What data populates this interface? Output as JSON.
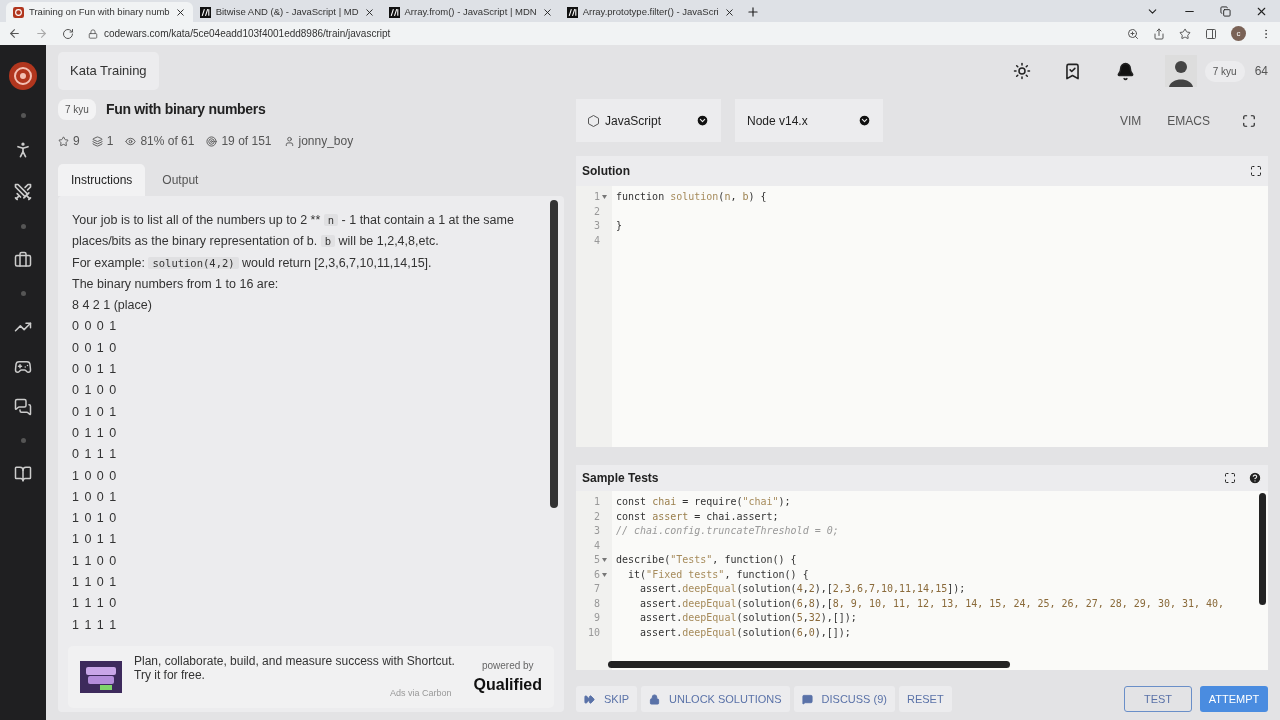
{
  "browser": {
    "tabs": [
      {
        "title": "Training on Fun with binary numb",
        "selected": true,
        "kind": "codewars"
      },
      {
        "title": "Bitwise AND (&) - JavaScript | MD",
        "selected": false,
        "kind": "mdn"
      },
      {
        "title": "Array.from() - JavaScript | MDN",
        "selected": false,
        "kind": "mdn"
      },
      {
        "title": "Array.prototype.filter() - JavaScri",
        "selected": false,
        "kind": "mdn"
      }
    ],
    "url": "codewars.com/kata/5ce04eadd103f4001edd8986/train/javascript",
    "profile_initial": "c"
  },
  "header": {
    "title": "Kata Training",
    "rank": "7 kyu",
    "honor": "64"
  },
  "kata": {
    "rank": "7 kyu",
    "title": "Fun with binary numbers",
    "stats": [
      {
        "kind": "stars",
        "text": "9"
      },
      {
        "kind": "collections",
        "text": "1"
      },
      {
        "kind": "satisfaction",
        "text": "81%",
        "suffix": "of 61"
      },
      {
        "kind": "completed",
        "text": "19",
        "suffix": "of 151"
      },
      {
        "kind": "author",
        "text": "jonny_boy"
      }
    ],
    "tabs": [
      {
        "label": "Instructions",
        "selected": true
      },
      {
        "label": "Output",
        "selected": false
      }
    ],
    "instructions": [
      [
        {
          "text": "Your job is to list all of the numbers up to 2 ** ",
          "kind": "text"
        },
        {
          "text": "n",
          "kind": "code"
        },
        {
          "text": " - 1 that contain a 1 at the same places/bits as the binary representation of b. ",
          "kind": "text"
        },
        {
          "text": "b",
          "kind": "code"
        },
        {
          "text": " will be 1,2,4,8,etc.",
          "kind": "text"
        }
      ],
      [
        {
          "text": "For example: ",
          "kind": "text"
        },
        {
          "text": "solution(4,2)",
          "kind": "code"
        },
        {
          "text": " would return [2,3,6,7,10,11,14,15].",
          "kind": "text"
        }
      ],
      [
        {
          "text": "The binary numbers from 1 to 16 are:",
          "kind": "text"
        }
      ],
      [
        {
          "text": "8 4 2 1 (place)",
          "kind": "text"
        }
      ]
    ],
    "binary_rows": [
      "0 0 0 1",
      "0 0 1 0",
      "0 0 1 1",
      "0 1 0 0",
      "0 1 0 1",
      "0 1 1 0",
      "0 1 1 1",
      "1 0 0 0",
      "1 0 0 1",
      "1 0 1 0",
      "1 0 1 1",
      "1 1 0 0",
      "1 1 0 1",
      "1 1 1 0",
      "1 1 1 1"
    ]
  },
  "ad": {
    "text": "Plan, collaborate, build, and measure success with Shortcut.",
    "cta": "Try it for free.",
    "via": "Ads via Carbon",
    "powered_by": "powered by",
    "brand": "Qualified"
  },
  "toolbar": {
    "language": "JavaScript",
    "version": "Node v14.x",
    "modes": [
      "VIM",
      "EMACS"
    ]
  },
  "solution": {
    "title": "Solution",
    "lines": [
      {
        "number": "1",
        "fold": true,
        "tokens": [
          {
            "text": "function ",
            "kind": "kw"
          },
          {
            "text": "solution",
            "kind": "fn"
          },
          {
            "text": "(",
            "kind": "p"
          },
          {
            "text": "n",
            "kind": "var"
          },
          {
            "text": ", ",
            "kind": "p"
          },
          {
            "text": "b",
            "kind": "var"
          },
          {
            "text": ") {",
            "kind": "p"
          }
        ]
      },
      {
        "number": "2",
        "fold": false
      },
      {
        "number": "3",
        "fold": false,
        "tokens": [
          {
            "text": "}",
            "kind": "p"
          }
        ]
      },
      {
        "number": "4",
        "fold": false
      }
    ]
  },
  "tests": {
    "title": "Sample Tests",
    "lines": [
      {
        "number": "1",
        "fold": false,
        "tokens": [
          {
            "text": "const ",
            "kind": "kw"
          },
          {
            "text": "chai",
            "kind": "var"
          },
          {
            "text": " = require(",
            "kind": "p"
          },
          {
            "text": "\"chai\"",
            "kind": "str"
          },
          {
            "text": ");",
            "kind": "p"
          }
        ]
      },
      {
        "number": "2",
        "fold": false,
        "tokens": [
          {
            "text": "const ",
            "kind": "kw"
          },
          {
            "text": "assert",
            "kind": "var"
          },
          {
            "text": " = chai.assert;",
            "kind": "p"
          }
        ]
      },
      {
        "number": "3",
        "fold": false,
        "tokens": [
          {
            "text": "// chai.config.truncateThreshold = 0;",
            "kind": "comment"
          }
        ]
      },
      {
        "number": "4",
        "fold": false
      },
      {
        "number": "5",
        "fold": true,
        "tokens": [
          {
            "text": "describe(",
            "kind": "p"
          },
          {
            "text": "\"Tests\"",
            "kind": "str"
          },
          {
            "text": ", function() {",
            "kind": "p"
          }
        ]
      },
      {
        "number": "6",
        "fold": true,
        "tokens": [
          {
            "text": "  it(",
            "kind": "p"
          },
          {
            "text": "\"Fixed tests\"",
            "kind": "str"
          },
          {
            "text": ", function() {",
            "kind": "p"
          }
        ]
      },
      {
        "number": "7",
        "fold": false,
        "tokens": [
          {
            "text": "    assert.",
            "kind": "p"
          },
          {
            "text": "deepEqual",
            "kind": "fn"
          },
          {
            "text": "(solution(",
            "kind": "p"
          },
          {
            "text": "4",
            "kind": "num"
          },
          {
            "text": ",",
            "kind": "p"
          },
          {
            "text": "2",
            "kind": "num"
          },
          {
            "text": "),[",
            "kind": "p"
          },
          {
            "text": "2,3,6,7,10,11,14,15",
            "kind": "num"
          },
          {
            "text": "]);",
            "kind": "p"
          }
        ]
      },
      {
        "number": "8",
        "fold": false,
        "tokens": [
          {
            "text": "    assert.",
            "kind": "p"
          },
          {
            "text": "deepEqual",
            "kind": "fn"
          },
          {
            "text": "(solution(",
            "kind": "p"
          },
          {
            "text": "6",
            "kind": "num"
          },
          {
            "text": ",",
            "kind": "p"
          },
          {
            "text": "8",
            "kind": "num"
          },
          {
            "text": "),[",
            "kind": "p"
          },
          {
            "text": "8, 9, 10, 11, 12, 13, 14, 15, 24, 25, 26, 27, 28, 29, 30, 31, 40,",
            "kind": "num"
          }
        ]
      },
      {
        "number": "9",
        "fold": false,
        "tokens": [
          {
            "text": "    assert.",
            "kind": "p"
          },
          {
            "text": "deepEqual",
            "kind": "fn"
          },
          {
            "text": "(solution(",
            "kind": "p"
          },
          {
            "text": "5",
            "kind": "num"
          },
          {
            "text": ",",
            "kind": "p"
          },
          {
            "text": "32",
            "kind": "num"
          },
          {
            "text": "),[]);",
            "kind": "p"
          }
        ]
      },
      {
        "number": "10",
        "fold": false,
        "tokens": [
          {
            "text": "    assert.",
            "kind": "p"
          },
          {
            "text": "deepEqual",
            "kind": "fn"
          },
          {
            "text": "(solution(",
            "kind": "p"
          },
          {
            "text": "6",
            "kind": "num"
          },
          {
            "text": ",",
            "kind": "p"
          },
          {
            "text": "0",
            "kind": "num"
          },
          {
            "text": "),[]);",
            "kind": "p"
          }
        ]
      }
    ]
  },
  "actions": [
    {
      "label": "SKIP",
      "kind": "skip"
    },
    {
      "label": "UNLOCK SOLUTIONS",
      "kind": "unlock"
    },
    {
      "label": "DISCUSS (9)",
      "kind": "discuss"
    },
    {
      "label": "RESET",
      "kind": "plain"
    }
  ],
  "run_buttons": [
    {
      "label": "TEST",
      "kind": "outline"
    },
    {
      "label": "ATTEMPT",
      "kind": "primary"
    }
  ]
}
